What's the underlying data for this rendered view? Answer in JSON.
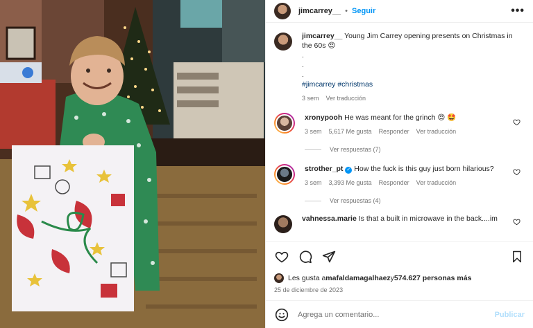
{
  "post": {
    "username": "jimcarrey__",
    "follow_label": "Seguir",
    "more_label": "•••"
  },
  "caption": {
    "username": "jimcarrey__",
    "text": "Young Jim Carrey opening presents on Christmas in the 60s 😍",
    "dots": [
      ".",
      ".",
      "."
    ],
    "hashtags": "#jimcarrey #christmas",
    "time": "3 sem",
    "translate": "Ver traducción"
  },
  "comments": [
    {
      "username": "xronypooh",
      "text": "He was meant for the grinch 😍 🤩",
      "time": "3 sem",
      "likes": "5,617 Me gusta",
      "reply": "Responder",
      "translate": "Ver traducción",
      "replies": "Ver respuestas (7)"
    },
    {
      "username": "strother_pt",
      "text": "How the fuck is this guy just born hilarious?",
      "time": "3 sem",
      "likes": "3,393 Me gusta",
      "reply": "Responder",
      "translate": "Ver traducción",
      "replies": "Ver respuestas (4)"
    },
    {
      "username": "vahnessa.marie",
      "text": "Is that a built in microwave in the back....im"
    }
  ],
  "likes": {
    "prefix": "Les gusta a ",
    "user": "mafaldamagalhaez",
    "middle": " y ",
    "count": "574.627 personas más"
  },
  "date": "25 de diciembre de 2023",
  "add_comment": {
    "placeholder": "Agrega un comentario...",
    "post_label": "Publicar"
  },
  "icons": {
    "like": "heart-icon",
    "comment": "comment-icon",
    "share": "share-icon",
    "save": "bookmark-icon",
    "emoji": "emoji-icon"
  },
  "colors": {
    "accent": "#0095f6",
    "hashtag": "#00376b",
    "muted": "#737373"
  }
}
